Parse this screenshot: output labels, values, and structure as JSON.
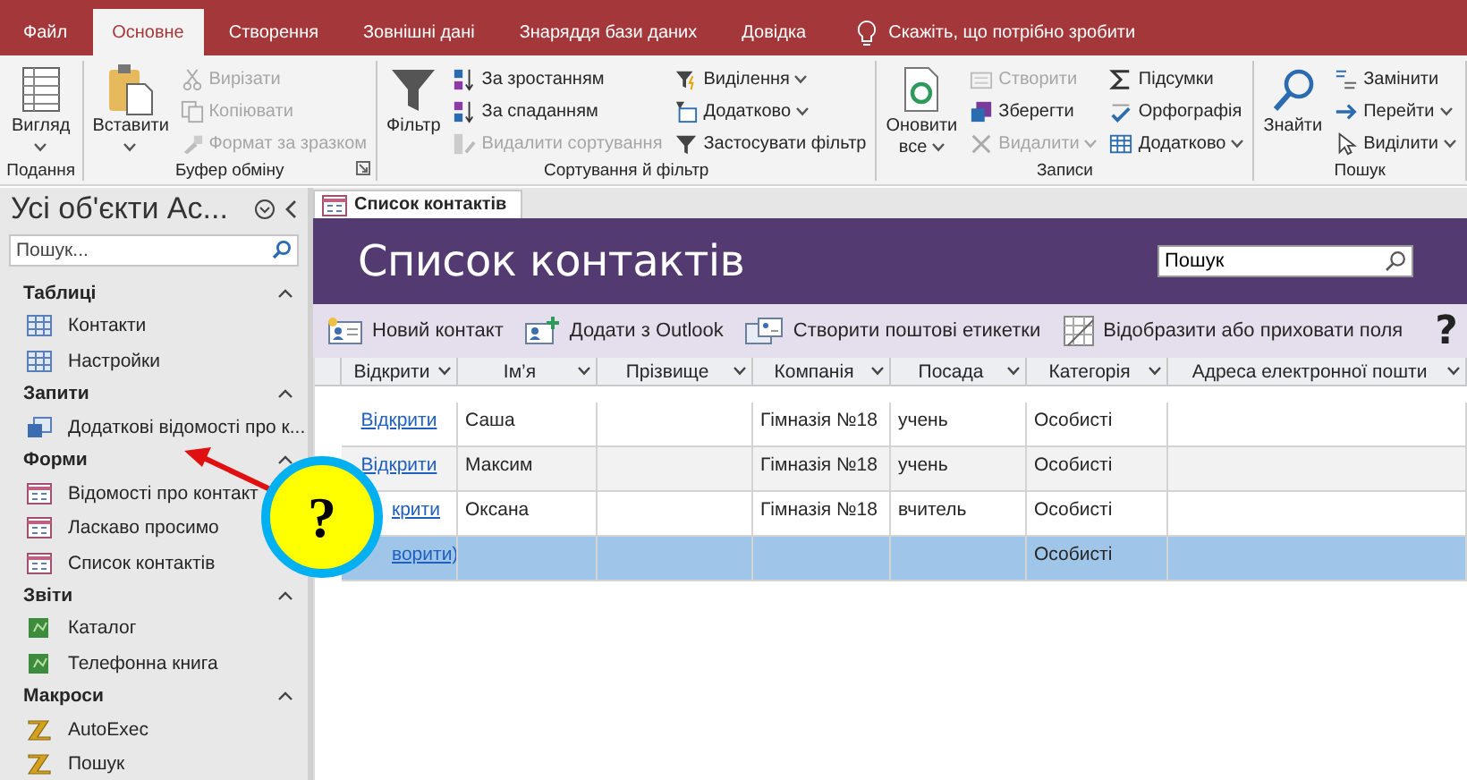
{
  "ribbon": {
    "tabs": [
      {
        "label": "Файл",
        "selected": false
      },
      {
        "label": "Основне",
        "selected": true
      },
      {
        "label": "Створення",
        "selected": false
      },
      {
        "label": "Зовнішні дані",
        "selected": false
      },
      {
        "label": "Знаряддя бази даних",
        "selected": false
      },
      {
        "label": "Довідка",
        "selected": false
      }
    ],
    "tell_me": "Скажіть, що потрібно зробити",
    "groups": [
      {
        "label": "Подання",
        "launcher": false,
        "columns": [
          [
            {
              "kind": "large",
              "label": "Вигляд",
              "dropdown": true,
              "disabled": false
            }
          ]
        ]
      },
      {
        "label": "Буфер обміну",
        "launcher": true,
        "columns": [
          [
            {
              "kind": "large",
              "label": "Вставити",
              "dropdown": true,
              "disabled": false
            }
          ],
          [
            {
              "kind": "small",
              "label": "Вирізати",
              "dropdown": false,
              "disabled": true
            },
            {
              "kind": "small",
              "label": "Копіювати",
              "dropdown": false,
              "disabled": true
            },
            {
              "kind": "small",
              "label": "Формат за зразком",
              "dropdown": false,
              "disabled": true
            }
          ]
        ]
      },
      {
        "label": "Сортування й фільтр",
        "launcher": false,
        "columns": [
          [
            {
              "kind": "large",
              "label": "Фільтр",
              "dropdown": false,
              "disabled": false
            }
          ],
          [
            {
              "kind": "small",
              "label": "За зростанням",
              "dropdown": false,
              "disabled": false
            },
            {
              "kind": "small",
              "label": "За спаданням",
              "dropdown": false,
              "disabled": false
            },
            {
              "kind": "small",
              "label": "Видалити сортування",
              "dropdown": false,
              "disabled": true
            }
          ],
          [
            {
              "kind": "small",
              "label": "Виділення",
              "dropdown": true,
              "disabled": false
            },
            {
              "kind": "small",
              "label": "Додатково",
              "dropdown": true,
              "disabled": false
            },
            {
              "kind": "small",
              "label": "Застосувати фільтр",
              "dropdown": false,
              "disabled": false
            }
          ]
        ]
      },
      {
        "label": "Записи",
        "launcher": false,
        "columns": [
          [
            {
              "kind": "large",
              "label": "Оновити все",
              "dropdown": true,
              "disabled": false
            }
          ],
          [
            {
              "kind": "small",
              "label": "Створити",
              "dropdown": false,
              "disabled": true
            },
            {
              "kind": "small",
              "label": "Зберегти",
              "dropdown": false,
              "disabled": false
            },
            {
              "kind": "small",
              "label": "Видалити",
              "dropdown": true,
              "disabled": true
            }
          ],
          [
            {
              "kind": "small",
              "label": "Підсумки",
              "dropdown": false,
              "disabled": false
            },
            {
              "kind": "small",
              "label": "Орфографія",
              "dropdown": false,
              "disabled": false
            },
            {
              "kind": "small",
              "label": "Додатково",
              "dropdown": true,
              "disabled": false
            }
          ]
        ]
      },
      {
        "label": "Пошук",
        "launcher": false,
        "columns": [
          [
            {
              "kind": "large",
              "label": "Знайти",
              "dropdown": false,
              "disabled": false
            }
          ],
          [
            {
              "kind": "small",
              "label": "Замінити",
              "dropdown": false,
              "disabled": false
            },
            {
              "kind": "small",
              "label": "Перейти",
              "dropdown": true,
              "disabled": false
            },
            {
              "kind": "small",
              "label": "Виділити",
              "dropdown": true,
              "disabled": false
            }
          ]
        ]
      }
    ]
  },
  "navigation": {
    "title": "Усі об'єкти Ac...",
    "search": {
      "placeholder": "Пошук..."
    },
    "sections": [
      {
        "label": "Таблиці",
        "expanded": true,
        "items": [
          {
            "kind": "table",
            "label": "Контакти"
          },
          {
            "kind": "table",
            "label": "Настройки"
          }
        ]
      },
      {
        "label": "Запити",
        "expanded": true,
        "items": [
          {
            "kind": "query",
            "label": "Додаткові відомості про к..."
          }
        ]
      },
      {
        "label": "Форми",
        "expanded": true,
        "items": [
          {
            "kind": "form",
            "label": "Відомості про контакт"
          },
          {
            "kind": "form",
            "label": "Ласкаво просимо"
          },
          {
            "kind": "form",
            "label": "Список контактів"
          }
        ]
      },
      {
        "label": "Звіти",
        "expanded": true,
        "items": [
          {
            "kind": "report",
            "label": "Каталог"
          },
          {
            "kind": "report",
            "label": "Телефонна книга"
          }
        ]
      },
      {
        "label": "Макроси",
        "expanded": true,
        "items": [
          {
            "kind": "macro",
            "label": "AutoExec"
          },
          {
            "kind": "macro",
            "label": "Пошук"
          }
        ]
      }
    ]
  },
  "document": {
    "tab": {
      "label": "Список контактів",
      "selected": true
    },
    "title": "Список контактів",
    "search": {
      "value": "Пошук"
    },
    "toolbar": [
      {
        "label": "Новий контакт"
      },
      {
        "label": "Додати з Outlook"
      },
      {
        "label": "Створити поштові етикетки"
      },
      {
        "label": "Відобразити або приховати поля"
      }
    ],
    "help": "?",
    "table": {
      "columns": [
        "Відкрити",
        "Ім’я",
        "Прізвище",
        "Компанія",
        "Посада",
        "Категорія",
        "Адреса електронної пошти"
      ],
      "rows": [
        {
          "selected": false,
          "cells": [
            "Відкрити",
            "Саша",
            "",
            "Гімназія №18",
            "учень",
            "Особисті",
            ""
          ]
        },
        {
          "selected": false,
          "cells": [
            "Відкрити",
            "Максим",
            "",
            "Гімназія №18",
            "учень",
            "Особисті",
            ""
          ]
        },
        {
          "selected": false,
          "cells": [
            "крити",
            "Оксана",
            "",
            "Гімназія №18",
            "вчитель",
            "Особисті",
            ""
          ]
        },
        {
          "selected": true,
          "cells": [
            "ворити)",
            "",
            "",
            "",
            "",
            "Особисті",
            ""
          ]
        }
      ]
    }
  },
  "callout": {
    "text": "?"
  }
}
